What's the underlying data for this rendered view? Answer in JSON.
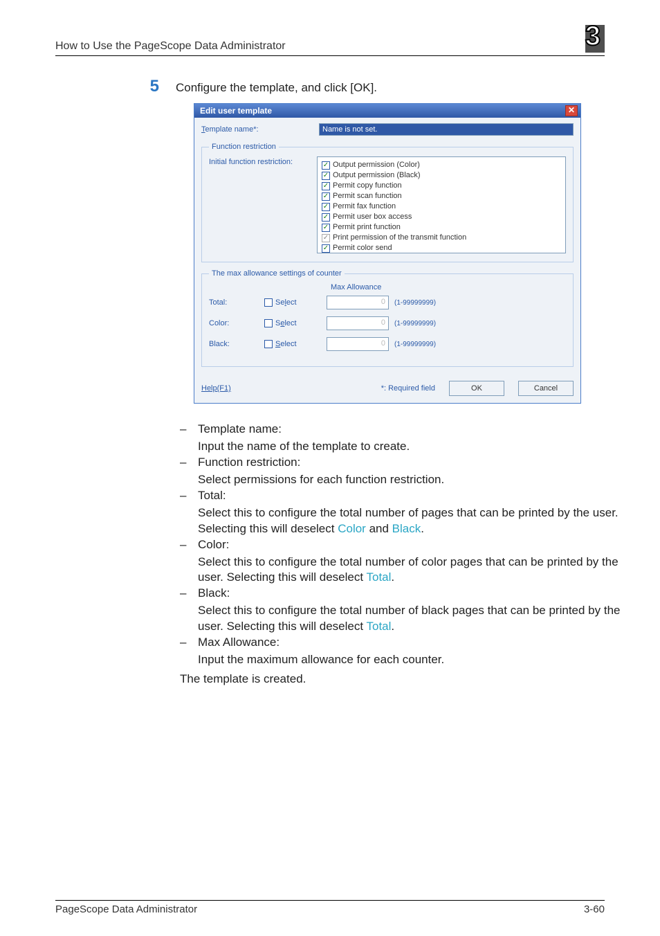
{
  "header": {
    "title": "How to Use the PageScope Data Administrator",
    "chapter_number": "3"
  },
  "step": {
    "number": "5",
    "text": "Configure the template, and click [OK]."
  },
  "dialog": {
    "title": "Edit user template",
    "template_name_label_pre": "T",
    "template_name_label_rest": "emplate name*:",
    "template_name_value": "Name is not set.",
    "fs_function_legend": "Function restriction",
    "initial_restriction_label": "Initial function restriction:",
    "permissions": [
      "Output permission (Color)",
      "Output permission (Black)",
      "Permit copy function",
      "Permit scan function",
      "Permit fax function",
      "Permit user box access",
      "Permit print function",
      "Print permission of the transmit function",
      "Permit color send"
    ],
    "fs_counter_legend": "The max allowance settings of counter",
    "max_allowance_label": "Max Allowance",
    "rows": [
      {
        "name": "Total:",
        "sel_label_pre": "Se",
        "sel_label_u": "l",
        "sel_label_post": "ect",
        "value": "0",
        "range": "(1-99999999)"
      },
      {
        "name": "Color:",
        "sel_label_pre": "S",
        "sel_label_u": "e",
        "sel_label_post": "lect",
        "value": "0",
        "range": "(1-99999999)"
      },
      {
        "name": "Black:",
        "sel_label_pre": "",
        "sel_label_u": "S",
        "sel_label_post": "elect",
        "value": "0",
        "range": "(1-99999999)"
      }
    ],
    "help_label": "Help(F1)",
    "required_label": "*: Required field",
    "ok_label": "OK",
    "cancel_label": "Cancel"
  },
  "explain": {
    "template_name_head": "Template name:",
    "template_name_body": "Input the name of the template to create.",
    "func_head": "Function restriction:",
    "func_body": "Select permissions for each function restriction.",
    "total_head": "Total:",
    "total_body_1": "Select this to configure the total number of pages that can be printed by the user. Selecting this will deselect ",
    "total_color": "Color",
    "total_and": " and ",
    "total_black": "Black",
    "total_period": ".",
    "color_head": "Color:",
    "color_body_1": "Select this to configure the total number of color pages that can be printed by the user. Selecting this will deselect ",
    "color_total": "Total",
    "color_period": ".",
    "black_head": "Black:",
    "black_body_1": "Select this to configure the total number of black pages that can be printed by the user. Selecting this will deselect ",
    "black_total": "Total",
    "black_period": ".",
    "max_head": "Max Allowance:",
    "max_body": "Input the maximum allowance for each counter."
  },
  "trail_text": "The template is created.",
  "footer": {
    "left": "PageScope Data Administrator",
    "right": "3-60"
  }
}
